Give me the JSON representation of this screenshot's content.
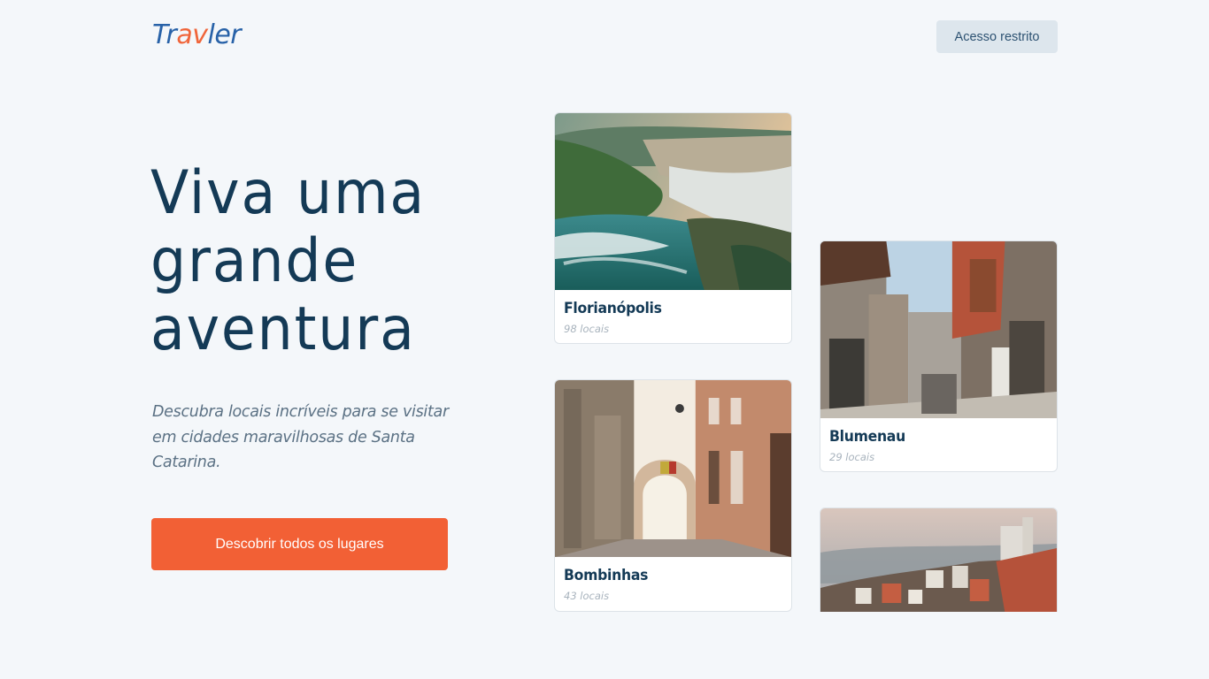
{
  "header": {
    "logo": {
      "part1": "Tr",
      "part2": "av",
      "part3": "ler"
    },
    "restricted_label": "Acesso restrito"
  },
  "hero": {
    "title_line1": "Viva uma",
    "title_line2": "grande",
    "title_line3": "aventura",
    "description": "Descubra locais incríveis para se visitar em cidades maravilhosas de Santa Catarina.",
    "cta_label": "Descobrir todos os lugares"
  },
  "cities": [
    {
      "name": "Florianópolis",
      "count": "98 locais"
    },
    {
      "name": "Bombinhas",
      "count": "43 locais"
    },
    {
      "name": "Blumenau",
      "count": "29 locais"
    }
  ],
  "colors": {
    "background": "#f4f7fa",
    "primary_text": "#143a56",
    "accent": "#f26035",
    "logo_blue": "#2862a8",
    "logo_orange": "#f0653a"
  }
}
